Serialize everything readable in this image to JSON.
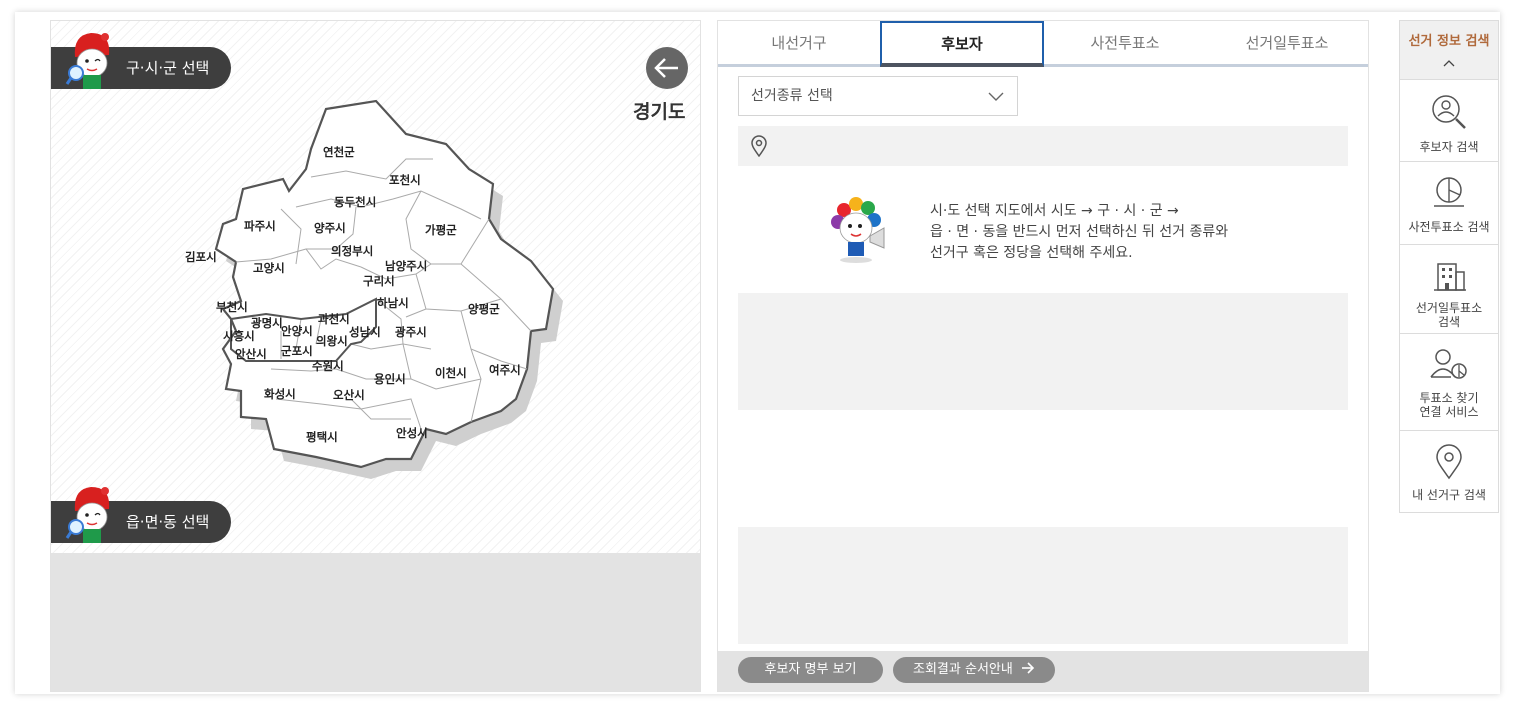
{
  "map": {
    "district_pill": "구·시·군 선택",
    "town_pill": "읍·면·동 선택",
    "province": "경기도",
    "regions": [
      "연천군",
      "포천시",
      "동두천시",
      "파주시",
      "양주시",
      "가평군",
      "의정부시",
      "김포시",
      "고양시",
      "남양주시",
      "구리시",
      "하남시",
      "부천시",
      "양평군",
      "광명시",
      "과천시",
      "시흥시",
      "안양시",
      "성남시",
      "광주시",
      "의왕시",
      "안산시",
      "군포시",
      "수원시",
      "용인시",
      "이천시",
      "여주시",
      "화성시",
      "오산시",
      "평택시",
      "안성시"
    ]
  },
  "tabs": [
    "내선거구",
    "후보자",
    "사전투표소",
    "선거일투표소"
  ],
  "active_tab": "후보자",
  "select": {
    "label": "선거종류 선택"
  },
  "notice": {
    "line1": "시·도 선택 지도에서 시도 → 구 · 시 · 군 →",
    "line2": "읍 · 면 · 동을 반드시 먼저 선택하신 뒤 선거 종류와",
    "line3": "선거구 혹은 정당을 선택해 주세요."
  },
  "buttons": {
    "candidate_list": "후보자 명부 보기",
    "order_guide": "조회결과 순서안내"
  },
  "sidebar": {
    "title": "선거 정보 검색",
    "items": [
      {
        "label1": "후보자 검색",
        "label2": "",
        "icon": "person-search-icon"
      },
      {
        "label1": "사전투표소 검색",
        "label2": "",
        "icon": "pie-chart-icon"
      },
      {
        "label1": "선거일투표소",
        "label2": "검색",
        "icon": "building-icon"
      },
      {
        "label1": "투표소 찾기",
        "label2": "연결 서비스",
        "icon": "person-clock-icon"
      },
      {
        "label1": "내 선거구 검색",
        "label2": "",
        "icon": "map-pin-icon"
      }
    ]
  },
  "colors": {
    "accent": "#1f5fab",
    "sidebar_title": "#b06a3c",
    "pill": "#3e3e3e"
  }
}
